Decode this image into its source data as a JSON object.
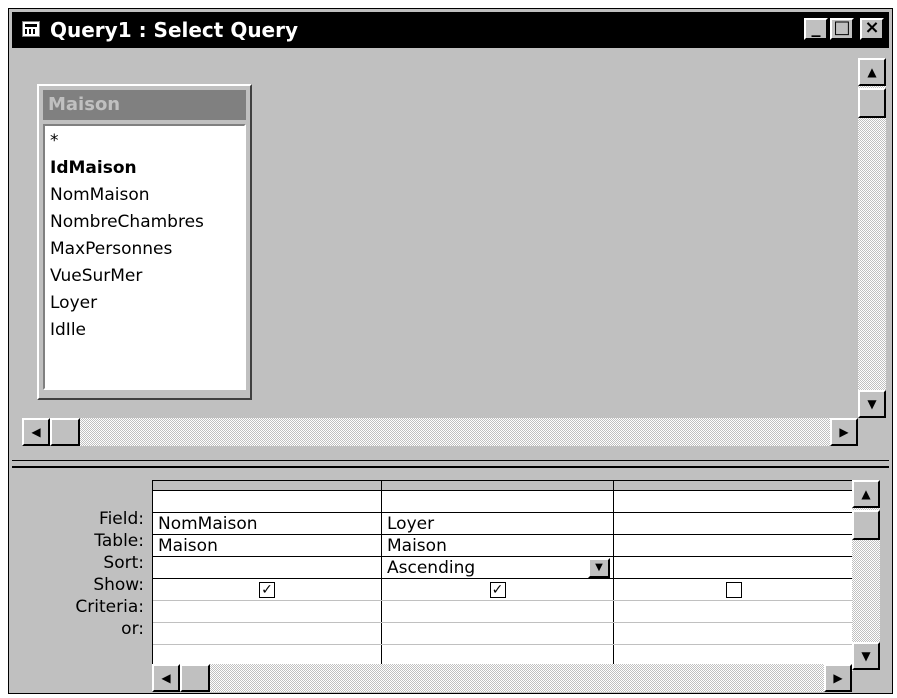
{
  "window": {
    "title": "Query1 : Select Query",
    "minimize_glyph": "_",
    "maximize_glyph": "□",
    "close_glyph": "×"
  },
  "table_box": {
    "name": "Maison",
    "fields": [
      {
        "name": "*",
        "primary_key": false
      },
      {
        "name": "IdMaison",
        "primary_key": true
      },
      {
        "name": "NomMaison",
        "primary_key": false
      },
      {
        "name": "NombreChambres",
        "primary_key": false
      },
      {
        "name": "MaxPersonnes",
        "primary_key": false
      },
      {
        "name": "VueSurMer",
        "primary_key": false
      },
      {
        "name": "Loyer",
        "primary_key": false
      },
      {
        "name": "IdIle",
        "primary_key": false
      }
    ]
  },
  "grid": {
    "row_labels": {
      "field": "Field:",
      "table": "Table:",
      "sort": "Sort:",
      "show": "Show:",
      "criteria": "Criteria:",
      "or": "or:"
    },
    "columns": [
      {
        "field": "NomMaison",
        "table": "Maison",
        "sort": "",
        "show": true,
        "criteria": "",
        "or": ""
      },
      {
        "field": "Loyer",
        "table": "Maison",
        "sort": "Ascending",
        "show": true,
        "criteria": "",
        "or": ""
      },
      {
        "field": "",
        "table": "",
        "sort": "",
        "show": false,
        "criteria": "",
        "or": ""
      }
    ]
  },
  "colors": {
    "titlebar": "#000000",
    "face": "#c0c0c0",
    "table_header": "#808080"
  },
  "glyphs": {
    "up": "▲",
    "down": "▼",
    "left": "◀",
    "right": "▶",
    "dropdown": "▼",
    "check": "✓"
  }
}
